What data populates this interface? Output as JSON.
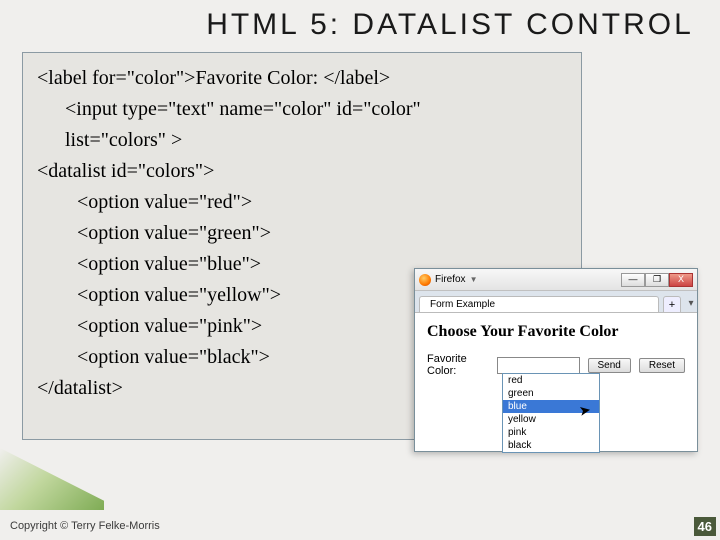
{
  "title": "HTML 5: DATALIST CONTROL",
  "code": {
    "l1": "<label for=\"color\">Favorite Color: </label>",
    "l2a": "<input type=\"text\" name=\"color\" id=\"color\"",
    "l2b": "list=\"colors\" >",
    "l3": "<datalist id=\"colors\">",
    "l4": "<option value=\"red\">",
    "l5": "<option value=\"green\">",
    "l6": "<option value=\"blue\">",
    "l7": "<option value=\"yellow\">",
    "l8": "<option value=\"pink\">",
    "l9": "<option value=\"black\">",
    "l10": "</datalist>"
  },
  "browser": {
    "app": "Firefox",
    "winbtns": {
      "min": "—",
      "max": "❐",
      "close": "X"
    },
    "tab": "Form Example",
    "plus": "+",
    "chev": "▾",
    "heading": "Choose Your Favorite Color",
    "label": "Favorite Color:",
    "send": "Send",
    "reset": "Reset",
    "options": [
      "red",
      "green",
      "blue",
      "yellow",
      "pink",
      "black"
    ],
    "selected_index": 2
  },
  "copyright": "Copyright © Terry Felke-Morris",
  "pagenum": "46"
}
